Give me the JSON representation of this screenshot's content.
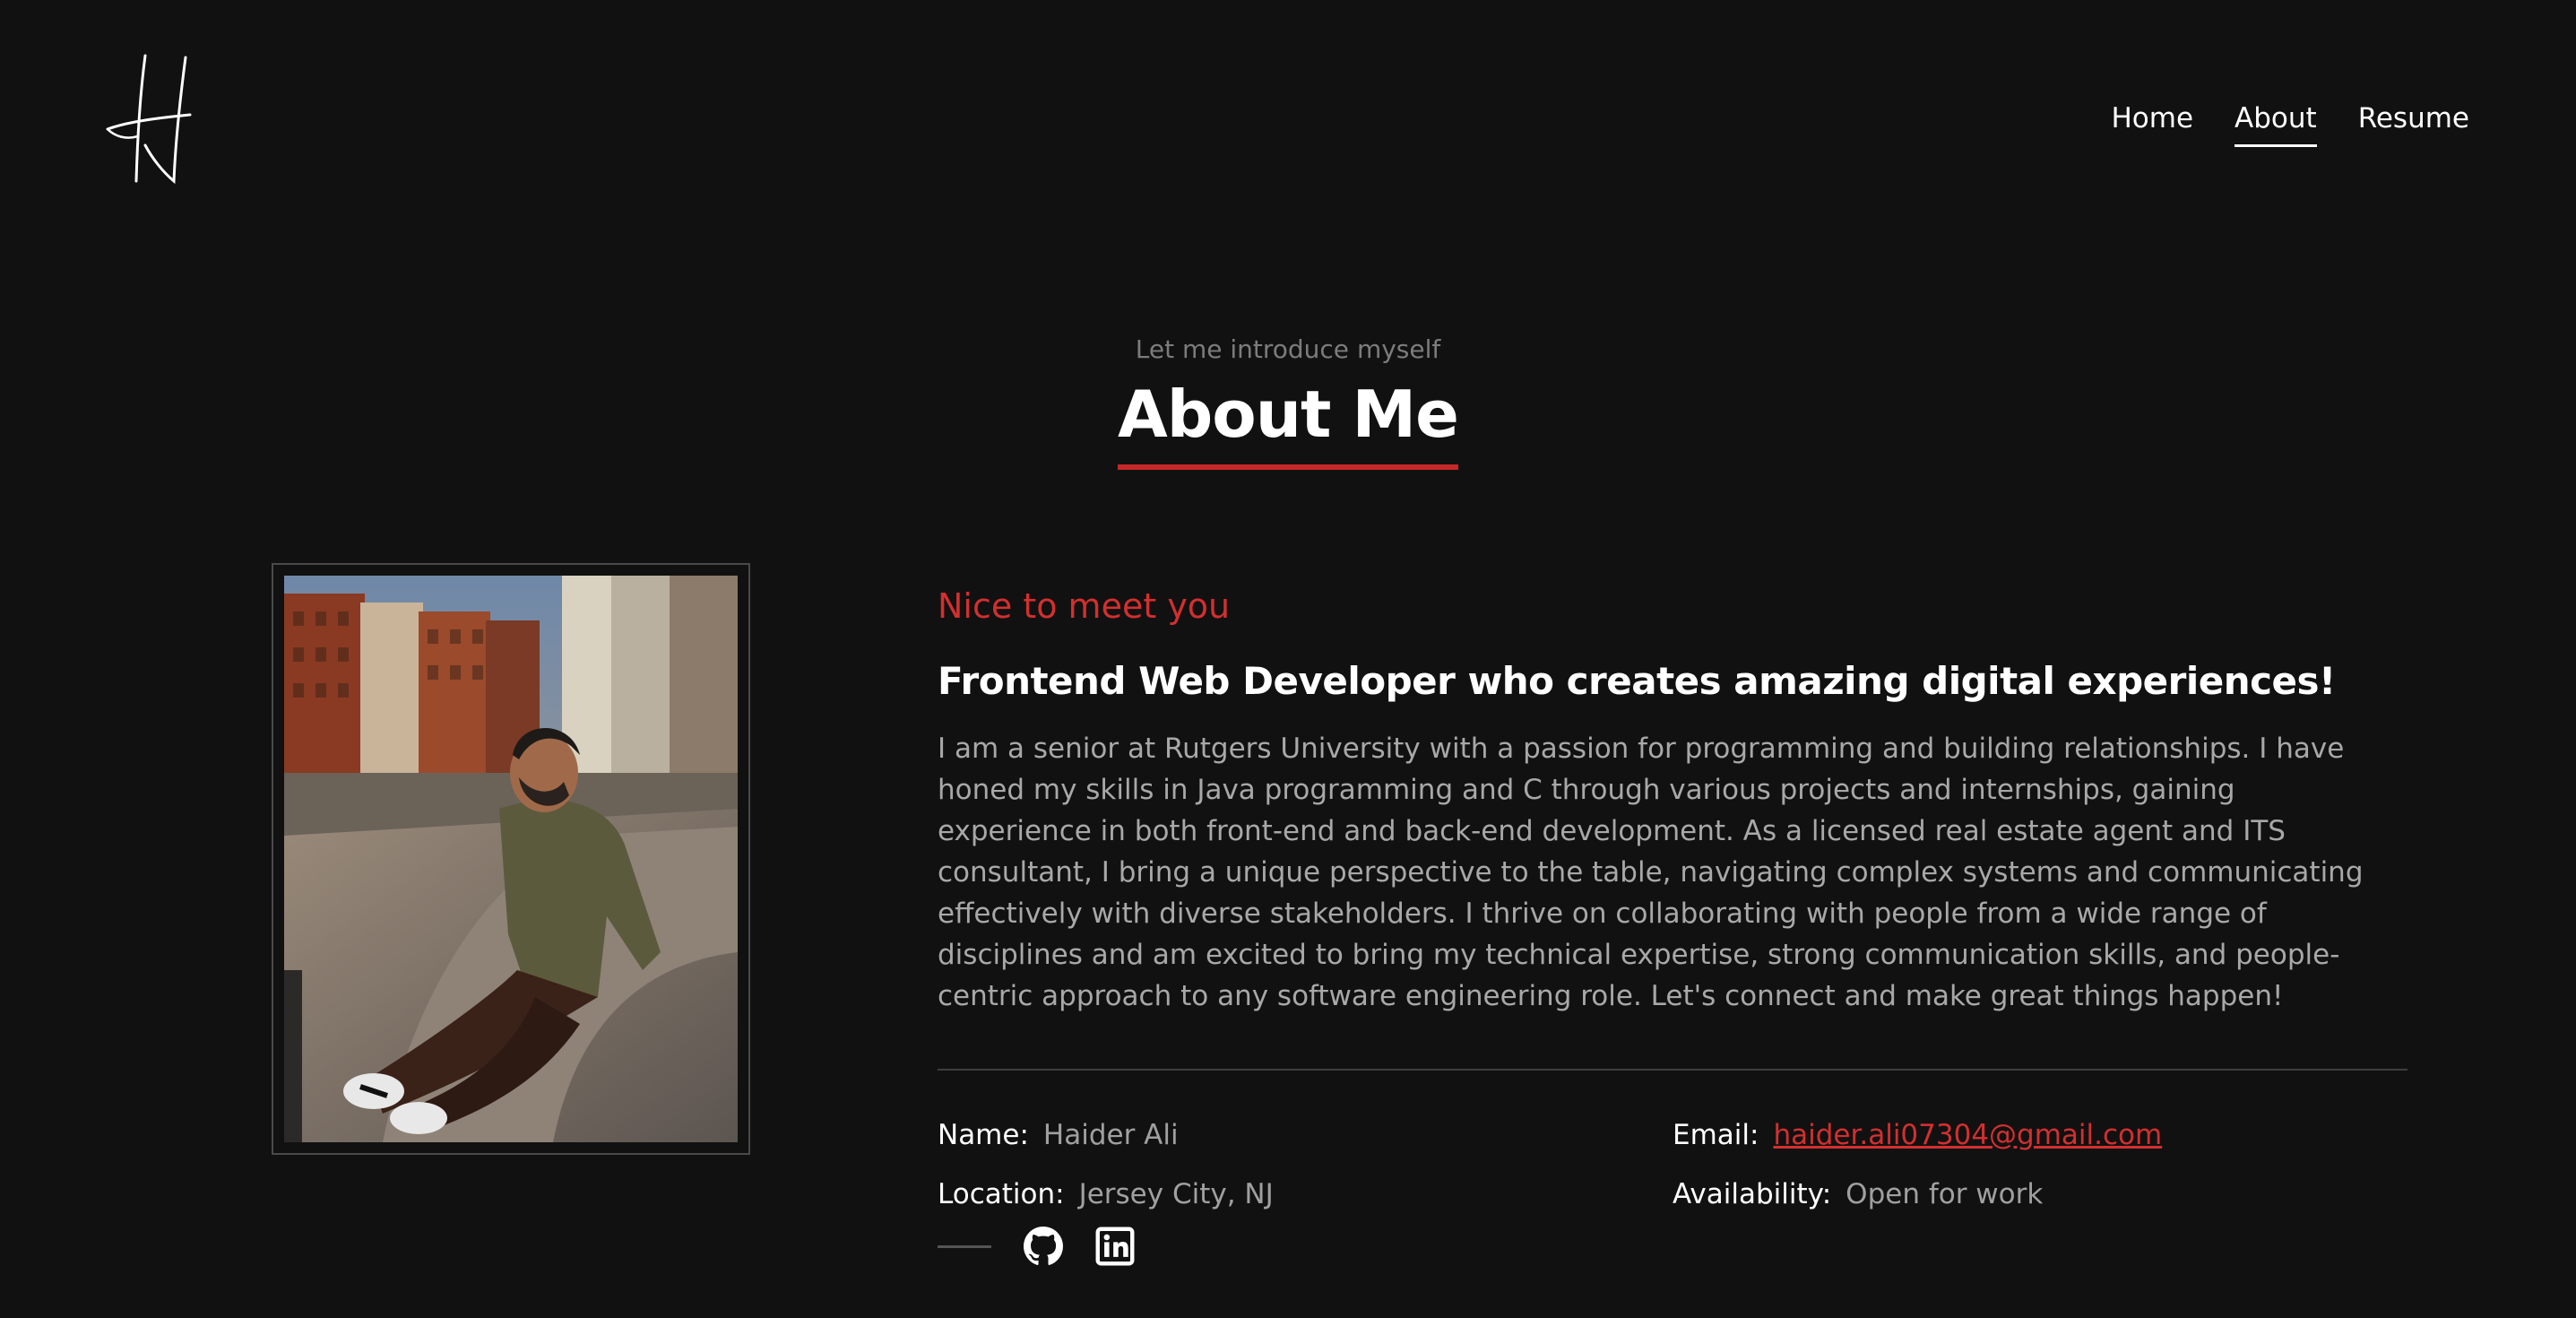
{
  "header": {
    "nav": [
      {
        "label": "Home",
        "active": false
      },
      {
        "label": "About",
        "active": true
      },
      {
        "label": "Resume",
        "active": false
      }
    ]
  },
  "about": {
    "intro": "Let me introduce myself",
    "title": "About Me",
    "greeting": "Nice to meet you",
    "headline": "Frontend Web Developer who creates amazing digital experiences!",
    "bio": "I am a senior at Rutgers University with a passion for programming and building relationships. I have honed my skills in Java programming and C through various projects and internships, gaining experience in both front-end and back-end development. As a licensed real estate agent and ITS consultant, I bring a unique perspective to the table, navigating complex systems and communicating effectively with diverse stakeholders. I thrive on collaborating with people from a wide range of disciplines and am excited to bring my technical expertise, strong communication skills, and people-centric approach to any software engineering role. Let's connect and make great things happen!",
    "info": {
      "name_label": "Name:",
      "name": "Haider Ali",
      "email_label": "Email:",
      "email": "haider.ali07304@gmail.com",
      "location_label": "Location:",
      "location": "Jersey City, NJ",
      "availability_label": "Availability:",
      "availability": "Open for work"
    },
    "social_icons": [
      "github-icon",
      "linkedin-icon"
    ]
  },
  "colors": {
    "background": "#111111",
    "accent": "#c62828",
    "text_muted": "#a8a8a8"
  }
}
